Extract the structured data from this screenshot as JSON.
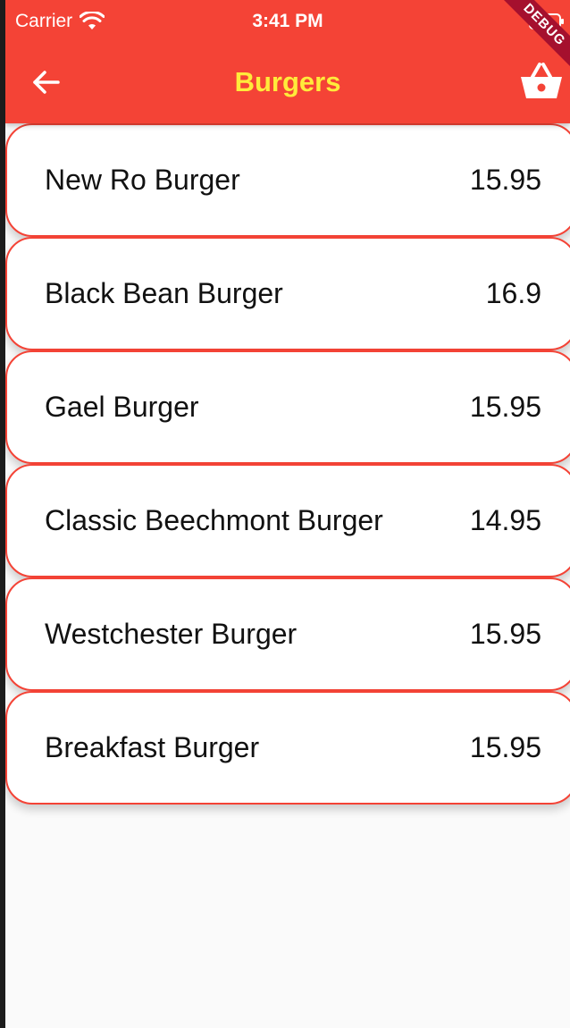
{
  "status_bar": {
    "carrier": "Carrier",
    "time": "3:41 PM"
  },
  "app_bar": {
    "title": "Burgers",
    "background_color": "#f44336",
    "title_color": "#ffeb3b",
    "back_icon": "arrow-back-icon",
    "cart_icon": "basket-icon"
  },
  "debug_banner": "DEBUG",
  "menu_items": [
    {
      "name": "New Ro Burger",
      "price": "15.95"
    },
    {
      "name": "Black Bean Burger",
      "price": "16.9"
    },
    {
      "name": "Gael Burger",
      "price": "15.95"
    },
    {
      "name": "Classic Beechmont Burger",
      "price": "14.95"
    },
    {
      "name": "Westchester Burger",
      "price": "15.95"
    },
    {
      "name": "Breakfast Burger",
      "price": "15.95"
    }
  ]
}
